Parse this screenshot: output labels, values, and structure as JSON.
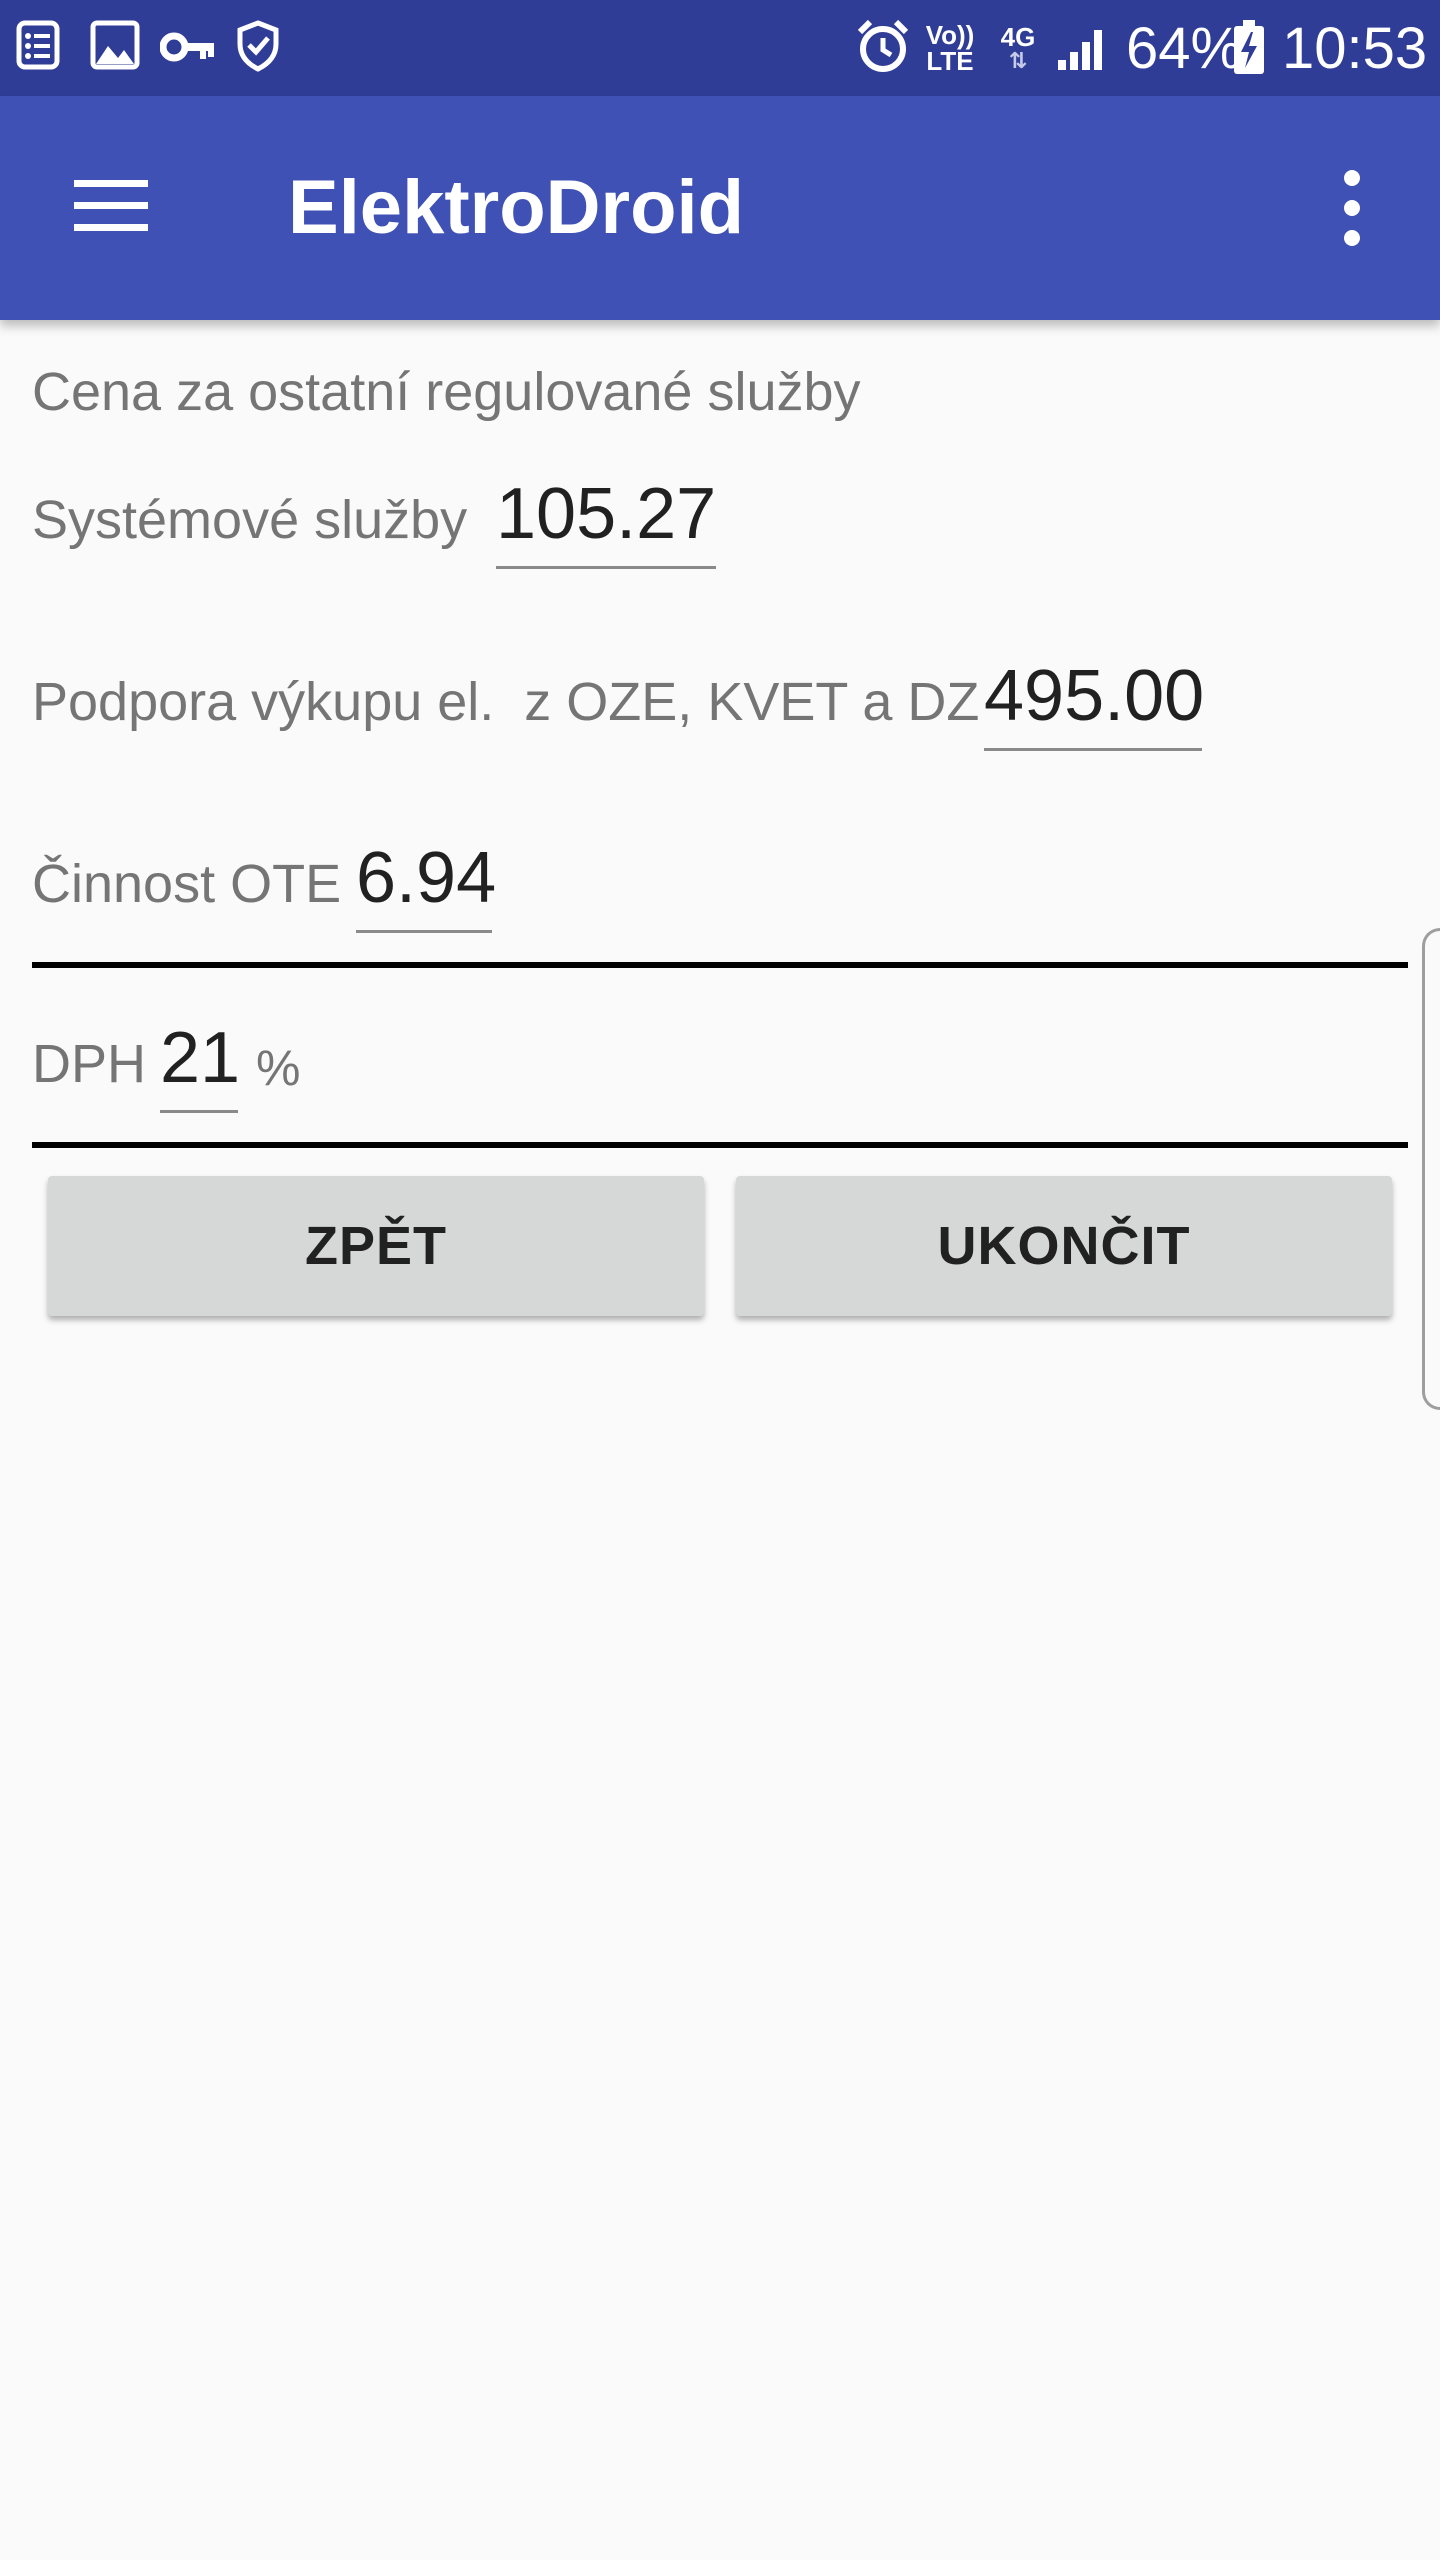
{
  "status_bar": {
    "battery_percent": "64%",
    "network": "4G",
    "volte": "Vo)) LTE",
    "time": "10:53",
    "icons": [
      "notes-icon",
      "image-icon",
      "key-icon",
      "shield-check-icon",
      "alarm-icon",
      "volte-icon",
      "network-4g-icon",
      "signal-icon",
      "battery-charging-icon"
    ]
  },
  "app_bar": {
    "title": "ElektroDroid",
    "menu_icon": "hamburger-menu-icon",
    "overflow_icon": "more-vert-icon"
  },
  "form": {
    "section_title": "Cena za ostatní regulované služby",
    "systemove_label": "Systémové služby",
    "systemove_value": "105.27",
    "podpora_label": "Podpora výkupu el.  z OZE, KVET a DZ",
    "podpora_value": "495.00",
    "cinnost_label": "Činnost OTE",
    "cinnost_value": "6.94",
    "dph_label": "DPH",
    "dph_value": "21",
    "dph_unit": "%"
  },
  "buttons": {
    "back": "ZPĚT",
    "quit": "UKONČIT"
  },
  "colors": {
    "status_bar": "#2f3d97",
    "app_bar": "#3f51b5",
    "background": "#fafafa",
    "button": "#d6d7d7"
  }
}
